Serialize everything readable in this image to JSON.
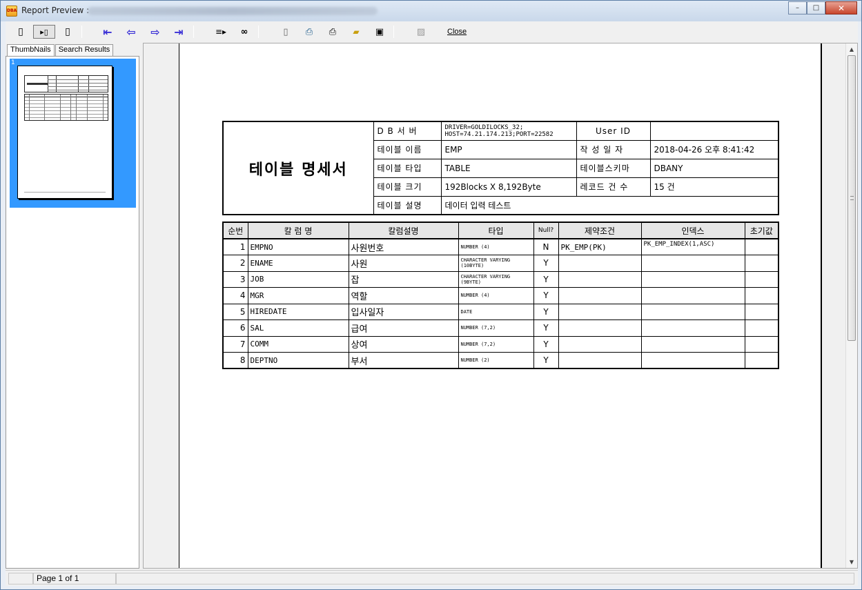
{
  "window": {
    "title": "Report Preview :",
    "minimize": "–",
    "maximize": "□",
    "close": "✕"
  },
  "toolbar": {
    "close_label": "Close"
  },
  "left_pane": {
    "tabs": [
      "ThumbNails",
      "Search Results"
    ],
    "thumb_number": "1"
  },
  "status": {
    "page_info": "Page 1 of 1"
  },
  "report": {
    "title": "테이블 명세서",
    "labels": {
      "db_server": "D B  서 버",
      "table_name": "테이블 이름",
      "table_type": "테이블 타입",
      "table_size": "테이블 크기",
      "table_desc": "테이블 설명",
      "user_id": "User ID",
      "created_at": "작 성  일 자",
      "schema": "테이블스키마",
      "record_count": "레코드 건 수"
    },
    "values": {
      "db_server_line1": "DRIVER=GOLDILOCKS_32;",
      "db_server_line2": "HOST=74.21.174.213;PORT=22582",
      "table_name": "EMP",
      "table_type": "TABLE",
      "table_size": "192Blocks X 8,192Byte",
      "table_desc": "데이터 입력 테스트",
      "user_id": "",
      "created_at": "2018-04-26 오후 8:41:42",
      "schema": "DBANY",
      "record_count": "15 건"
    },
    "columns_header": [
      "순번",
      "칼 럼 명",
      "칼럼설명",
      "타입",
      "Null?",
      "제약조건",
      "인덱스",
      "초기값"
    ],
    "rows": [
      {
        "no": "1",
        "name": "EMPNO",
        "desc": "사원번호",
        "type": "NUMBER (4)",
        "null": "N",
        "constraint": "PK_EMP(PK)",
        "index": "PK_EMP_INDEX(1,ASC)",
        "default": ""
      },
      {
        "no": "2",
        "name": "ENAME",
        "desc": "사원",
        "type": "CHARACTER VARYING (10BYTE)",
        "null": "Y",
        "constraint": "",
        "index": "",
        "default": ""
      },
      {
        "no": "3",
        "name": "JOB",
        "desc": "잡",
        "type": "CHARACTER VARYING (9BYTE)",
        "null": "Y",
        "constraint": "",
        "index": "",
        "default": ""
      },
      {
        "no": "4",
        "name": "MGR",
        "desc": "역할",
        "type": "NUMBER (4)",
        "null": "Y",
        "constraint": "",
        "index": "",
        "default": ""
      },
      {
        "no": "5",
        "name": "HIREDATE",
        "desc": "입사일자",
        "type": "DATE",
        "null": "Y",
        "constraint": "",
        "index": "",
        "default": ""
      },
      {
        "no": "6",
        "name": "SAL",
        "desc": "급여",
        "type": "NUMBER (7,2)",
        "null": "Y",
        "constraint": "",
        "index": "",
        "default": ""
      },
      {
        "no": "7",
        "name": "COMM",
        "desc": "상여",
        "type": "NUMBER (7,2)",
        "null": "Y",
        "constraint": "",
        "index": "",
        "default": ""
      },
      {
        "no": "8",
        "name": "DEPTNO",
        "desc": "부서",
        "type": "NUMBER (2)",
        "null": "Y",
        "constraint": "",
        "index": "",
        "default": ""
      }
    ]
  }
}
